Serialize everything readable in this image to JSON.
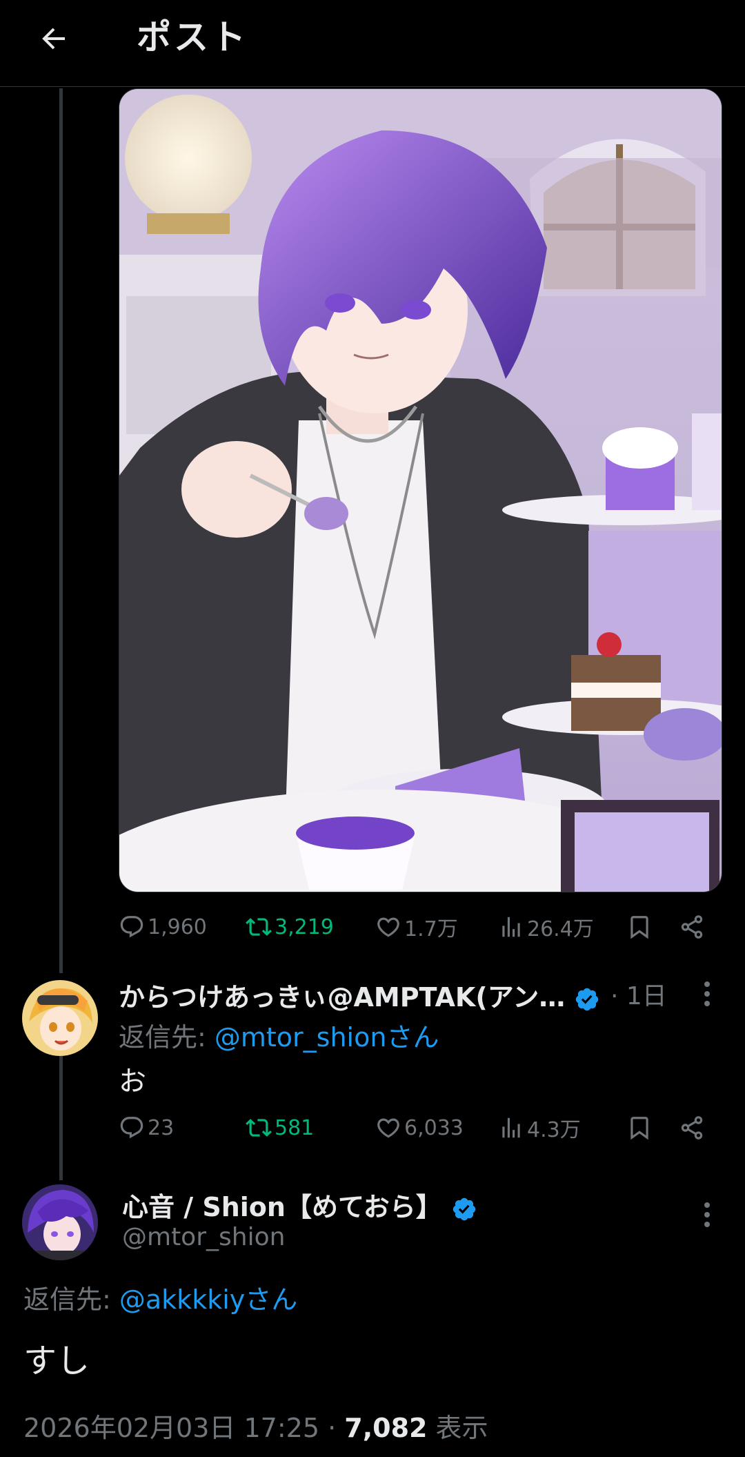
{
  "header": {
    "title": "ポスト"
  },
  "parent_post": {
    "actions": {
      "replies": "1,960",
      "reposts": "3,219",
      "likes": "1.7万",
      "views": "26.4万"
    }
  },
  "reply": {
    "display_name": "からつけあっきぃ@AMPTAK(アン…",
    "time_ago": "· 1日",
    "reply_to_prefix": "返信先: ",
    "reply_to_mention": "@mtor_shionさん",
    "text": "お",
    "actions": {
      "replies": "23",
      "reposts": "581",
      "likes": "6,033",
      "views": "4.3万"
    }
  },
  "main_post": {
    "display_name": "心音 / Shion【めておら】",
    "handle": "@mtor_shion",
    "reply_to_prefix": "返信先: ",
    "reply_to_mention": "@akkkkiyさん",
    "text": "すし",
    "timestamp": "2026年02月03日 17:25 · ",
    "views_count": "7,082",
    "views_label": " 表示"
  },
  "colors": {
    "background": "#000000",
    "accent": "#1d9bf0",
    "repost": "#00ba7c",
    "muted": "#71767b",
    "verified": "#1d9bf0"
  }
}
